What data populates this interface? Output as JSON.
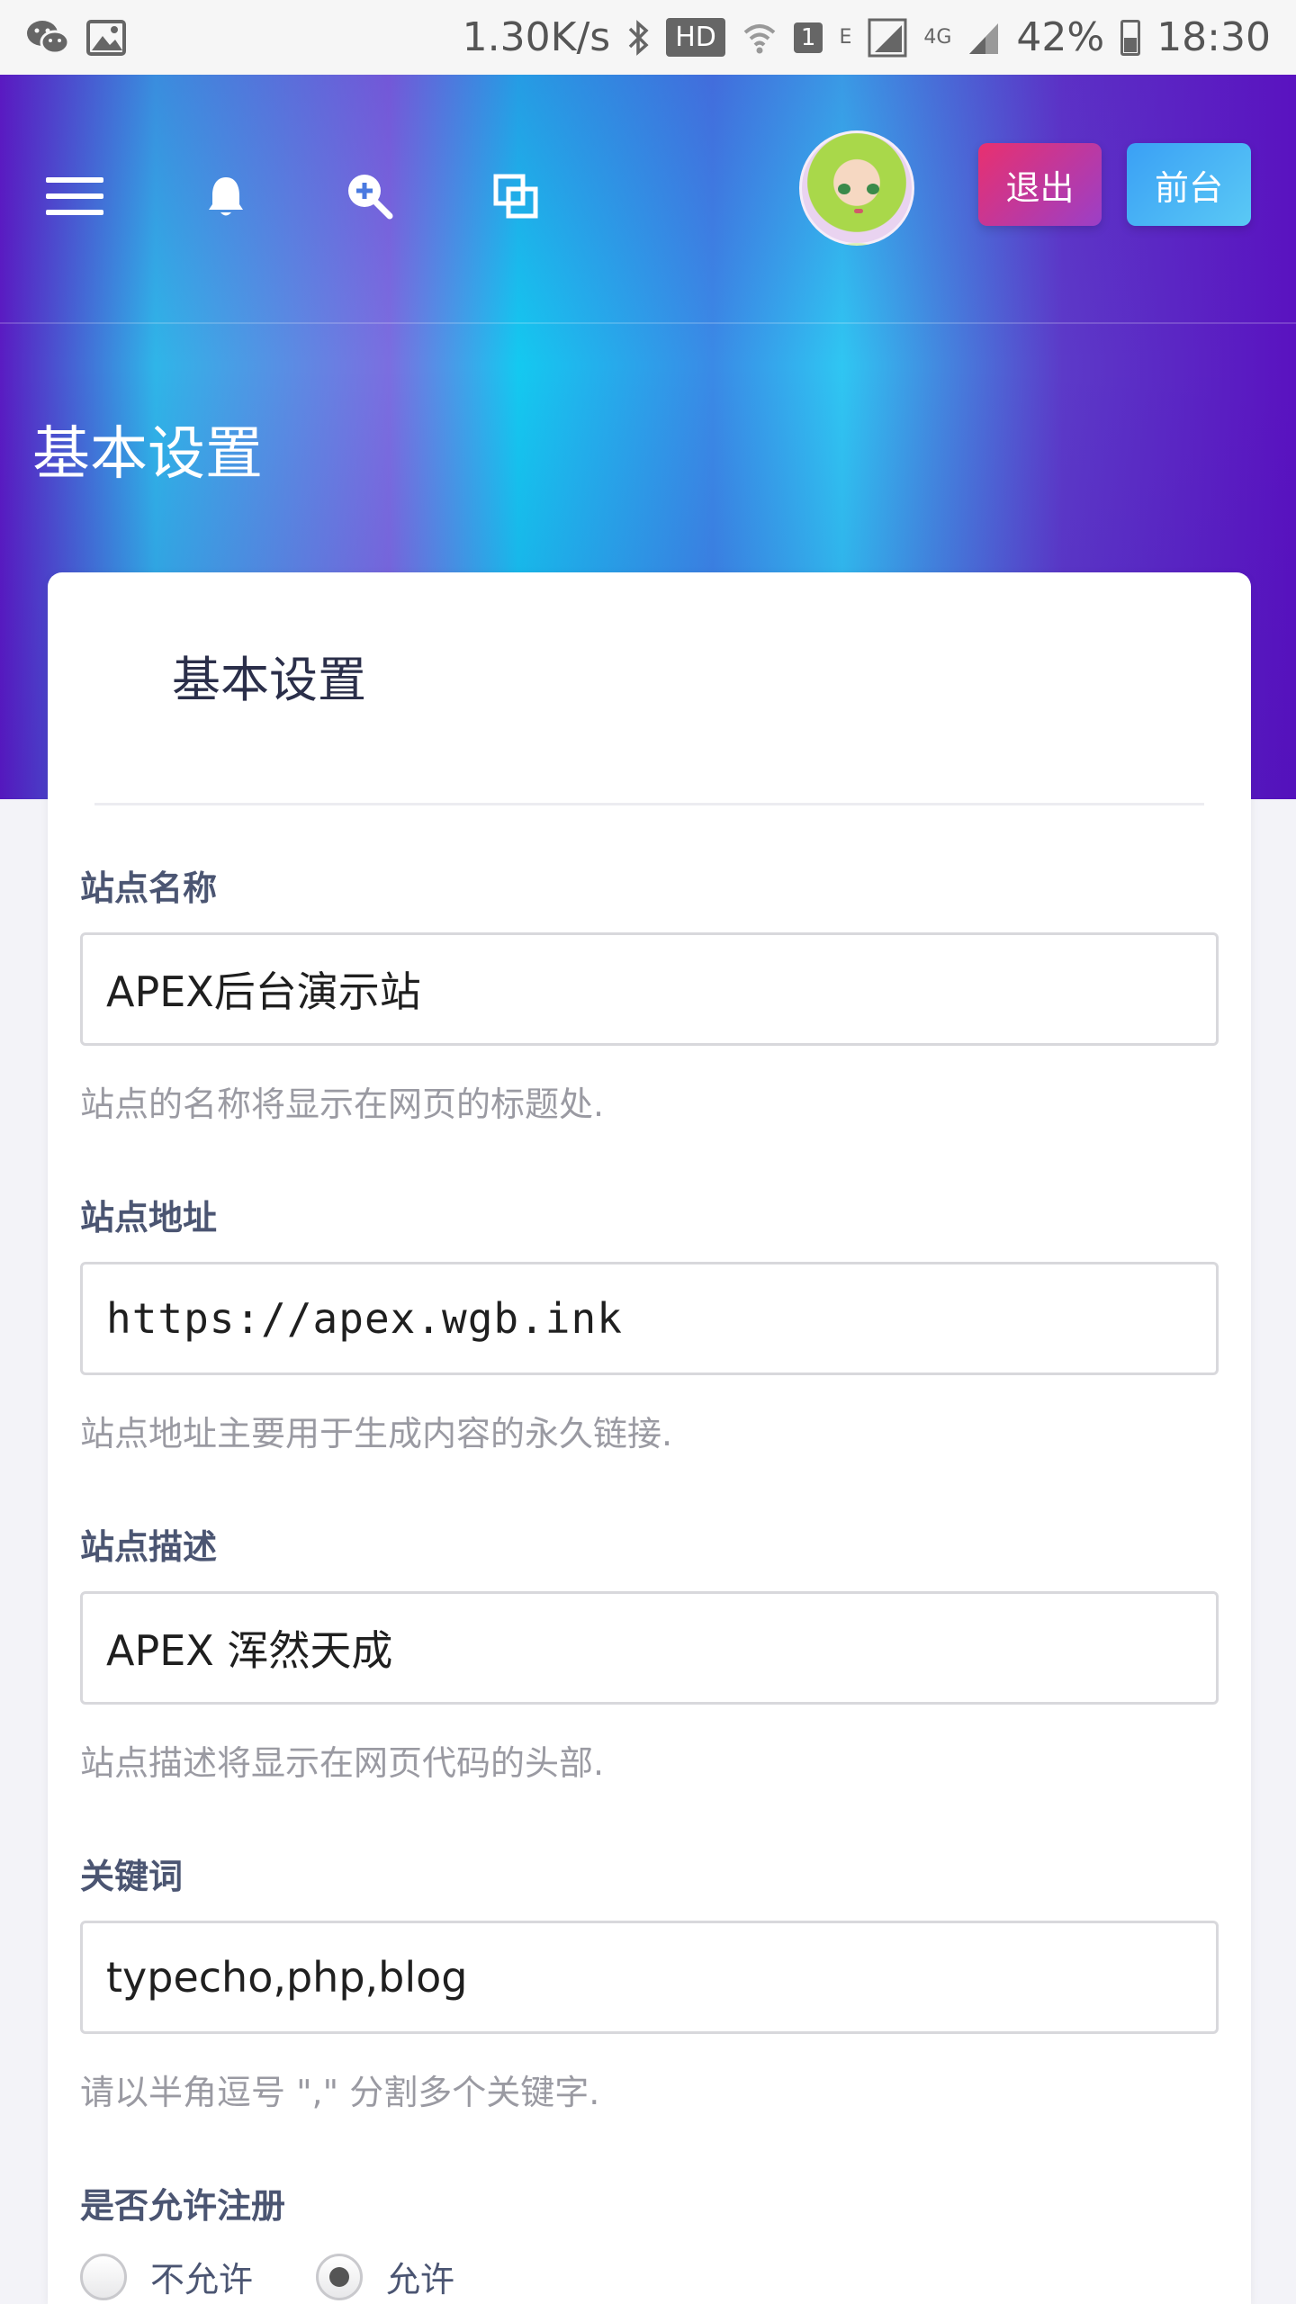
{
  "status_bar": {
    "network_speed": "1.30K/s",
    "hd_label": "HD",
    "sim_label": "1",
    "edge_label": "E",
    "lte_label": "4G",
    "battery_percent": "42%",
    "time": "18:30"
  },
  "topbar": {
    "logout_label": "退出",
    "front_label": "前台"
  },
  "hero": {
    "title": "基本设置"
  },
  "card": {
    "title": "基本设置"
  },
  "form": {
    "site_name": {
      "label": "站点名称",
      "value": "APEX后台演示站",
      "help": "站点的名称将显示在网页的标题处."
    },
    "site_url": {
      "label": "站点地址",
      "value": "https://apex.wgb.ink",
      "help": "站点地址主要用于生成内容的永久链接."
    },
    "site_description": {
      "label": "站点描述",
      "value": "APEX 浑然天成",
      "help": "站点描述将显示在网页代码的头部."
    },
    "keywords": {
      "label": "关键词",
      "value": "typecho,php,blog",
      "help": "请以半角逗号 \",\" 分割多个关键字."
    },
    "allow_register": {
      "label": "是否允许注册",
      "options": [
        {
          "label": "不允许",
          "checked": false
        },
        {
          "label": "允许",
          "checked": true
        }
      ]
    }
  },
  "colors": {
    "logout_button": "#e8306f",
    "front_button": "#3aa0f5",
    "label_text": "#4b5572",
    "help_text": "#9a9aa2"
  }
}
